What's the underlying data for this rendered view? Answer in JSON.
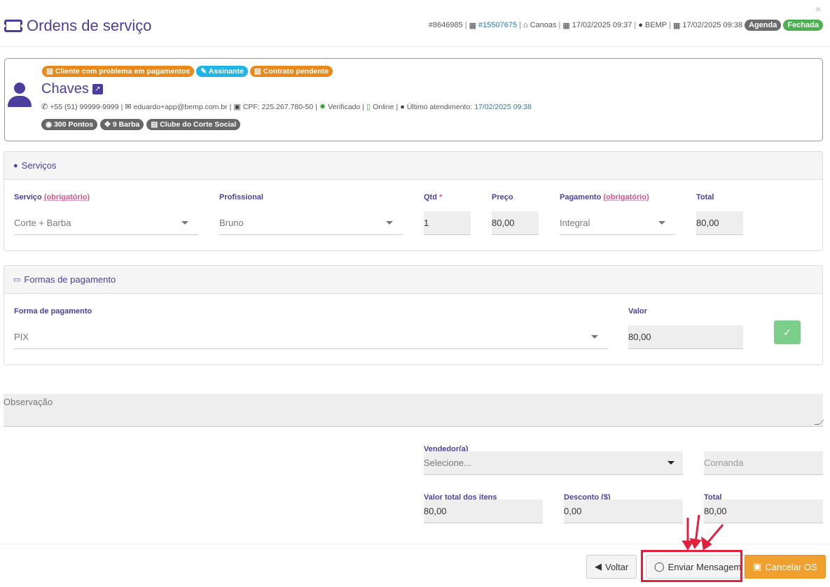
{
  "header": {
    "title": "Ordens de serviço",
    "close": "×",
    "order_id": "#8646985",
    "sep": "|",
    "ticket_link": "#15507675",
    "branch": "Canoas",
    "opened_at": "17/02/2025 09:37",
    "user": "BEMP",
    "closed_at": "17/02/2025 09:38",
    "badge_agenda": "Agenda",
    "badge_status": "Fechada"
  },
  "client": {
    "tags": [
      "Cliente com problema em pagamentos",
      "Assinante",
      "Contrato pendente"
    ],
    "name": "Chaves",
    "phone": "+55 (51) 99999-9999",
    "email": "eduardo+app@bemp.com.br",
    "cpf": "CPF: 225.267.780-50",
    "verified": "Verificado",
    "online": "Online",
    "last_label": "Último atendimento:",
    "last_value": "17/02/2025 09:38",
    "badges": [
      "300 Pontos",
      "9 Barba",
      "Clube do Corte Social"
    ]
  },
  "services": {
    "title": "Serviços",
    "labels": {
      "service": "Serviço",
      "required": "(obrigatório)",
      "professional": "Profissional",
      "qty": "Qtd",
      "star": "*",
      "price": "Preço",
      "payment": "Pagamento",
      "total": "Total"
    },
    "row": {
      "service": "Corte + Barba",
      "professional": "Bruno",
      "qty": "1",
      "price": "80,00",
      "payment": "Integral",
      "total": "80,00"
    }
  },
  "payments": {
    "title": "Formas de pagamento",
    "method_label": "Forma de pagamento",
    "method_value": "PIX",
    "value_label": "Valor",
    "value": "80,00"
  },
  "observation": {
    "placeholder": "Observação"
  },
  "footer_form": {
    "seller_label": "Vendedor(a)",
    "seller_placeholder": "Selecione...",
    "comanda_placeholder": "Comanda",
    "items_total_label": "Valor total dos itens",
    "items_total": "80,00",
    "discount_label": "Desconto ($)",
    "discount": "0,00",
    "total_label": "Total",
    "total": "80,00"
  },
  "actions": {
    "back": "Voltar",
    "send_message": "Enviar Mensagem",
    "cancel": "Cancelar OS"
  },
  "colors": {
    "primary": "#4a3f9e",
    "orange": "#e8891a",
    "blue": "#1fb5e6",
    "green": "#4caf50",
    "cancel": "#f0a02e",
    "highlight": "#e0203d"
  }
}
